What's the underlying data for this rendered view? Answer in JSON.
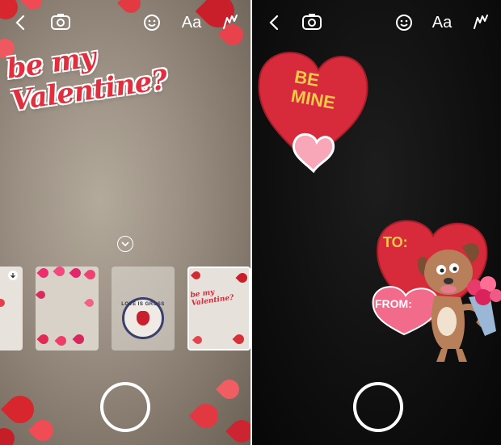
{
  "left": {
    "toolbar": {
      "text_label": "Aa"
    },
    "overlay_text": "be my Valentine?",
    "tray": {
      "thumbs": [
        {
          "kind": "download",
          "label": ""
        },
        {
          "kind": "hearts-frame",
          "label": ""
        },
        {
          "kind": "badge",
          "label": "LOVE IS GROSS"
        },
        {
          "kind": "valentine-frame",
          "label": "be my Valentine?"
        }
      ]
    }
  },
  "right": {
    "toolbar": {
      "text_label": "Aa"
    },
    "sticker_be_mine": "BE MINE",
    "sticker_to": "TO:",
    "sticker_from": "FROM:"
  },
  "colors": {
    "accent": "#e0283a",
    "gold": "#f2c94c",
    "pink": "#f59ab4"
  }
}
